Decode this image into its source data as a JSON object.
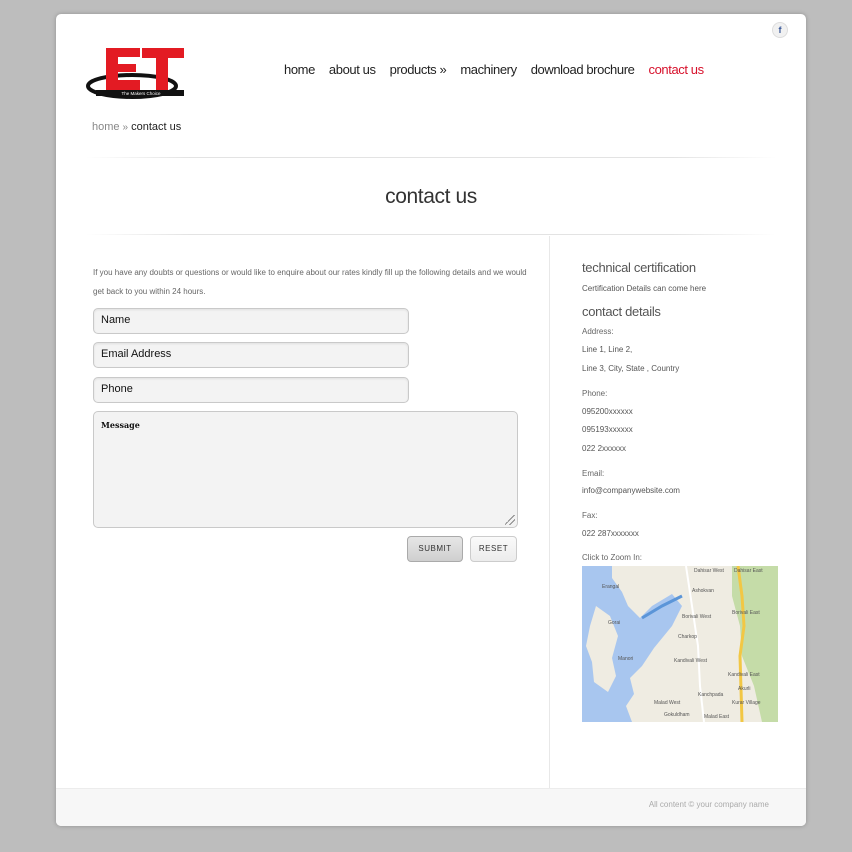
{
  "header": {
    "logo_text": "ET",
    "logo_tagline": "The Makers Choice",
    "facebook_icon_glyph": "f"
  },
  "nav": {
    "items": [
      {
        "label": "home",
        "active": false
      },
      {
        "label": "about us",
        "active": false
      },
      {
        "label": "products »",
        "active": false
      },
      {
        "label": "machinery",
        "active": false
      },
      {
        "label": "download brochure",
        "active": false
      },
      {
        "label": "contact us",
        "active": true
      }
    ],
    "active_color": "#d7102b"
  },
  "breadcrumb": {
    "home": "home",
    "separator": "»",
    "current": "contact us"
  },
  "page_title": "contact us",
  "form": {
    "intro": "If you have any doubts or questions or would like to enquire about our rates kindly fill up the following details and we would get back to you within 24 hours.",
    "name_placeholder": "Name",
    "email_placeholder": "Email Address",
    "phone_placeholder": "Phone",
    "message_placeholder": "Message",
    "submit_label": "SUBMIT",
    "reset_label": "RESET"
  },
  "sidebar": {
    "cert_heading": "technical certification",
    "cert_text": "Certification Details can come here",
    "contact_heading": "contact details",
    "address_label": "Address:",
    "address_line1": "Line 1, Line 2,",
    "address_line2": "Line 3, City, State , Country",
    "phone_label": "Phone:",
    "phone1": "095200xxxxxx",
    "phone2": "095193xxxxxx",
    "phone3": "022 2xxxxxx",
    "email_label": "Email:",
    "email": "info@companywebsite.com",
    "fax_label": "Fax:",
    "fax": "022 287xxxxxxx",
    "map_label": "Click to Zoom In:"
  },
  "map": {
    "labels": [
      "Dahisar West",
      "Dahisar East",
      "Gorai",
      "Borivali West",
      "Borivali East",
      "Manori",
      "Kandivali West",
      "Kandivali East",
      "Malad West",
      "Malad East",
      "Gokuldham",
      "Kurar Village",
      "Kanchpada",
      "Erangal",
      "Ashokvan",
      "Akurli",
      "Charkop"
    ]
  },
  "footer": {
    "copyright": "All content © your company name"
  },
  "colors": {
    "brand_red": "#e31b23",
    "background": "#bdbdbd"
  }
}
